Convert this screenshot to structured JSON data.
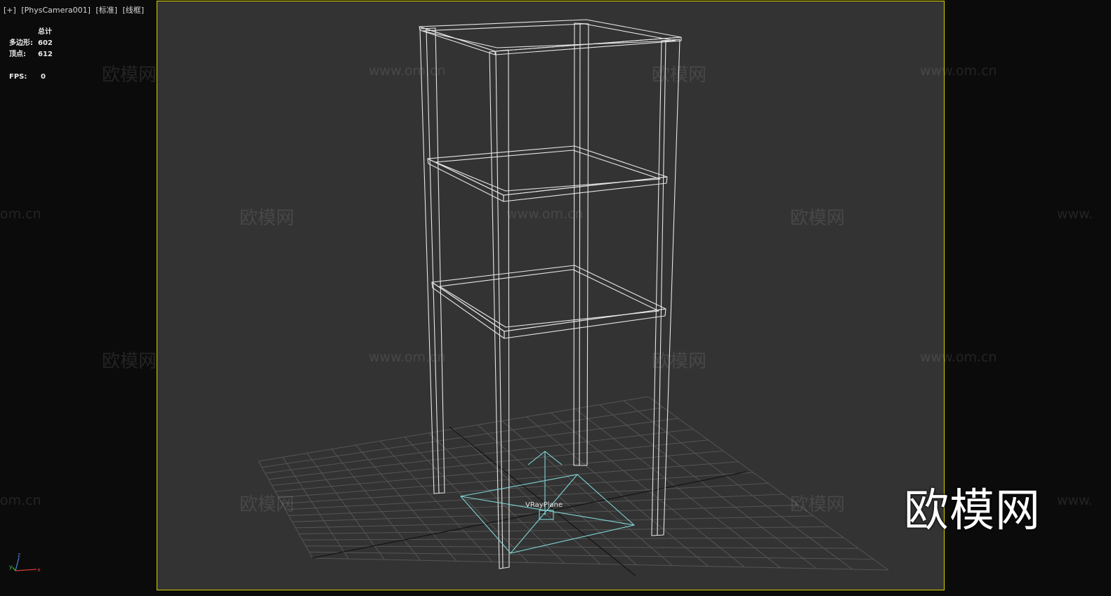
{
  "viewport": {
    "label_parts": [
      "[+]",
      "[PhysCamera001]",
      "[标准]",
      "[线框]"
    ],
    "frame_color": "#d8d000",
    "background_color": "#333333"
  },
  "stats": {
    "header": "总计",
    "polygons_label": "多边形:",
    "polygons": "602",
    "vertices_label": "顶点:",
    "vertices": "612",
    "fps_label": "FPS:",
    "fps": "0"
  },
  "scene": {
    "object_name": "VRayPlane",
    "wireframe_color": "#e6e6e6",
    "light_color": "#7fd6d6"
  },
  "watermarks": {
    "site": "欧模网",
    "url": "www.om.cn",
    "url_fragment_right": "www.",
    "url_fragment_left": "om.cn"
  },
  "logo": {
    "text": "欧模网"
  },
  "axis": {
    "x": "x",
    "y": "y",
    "z": "z"
  }
}
